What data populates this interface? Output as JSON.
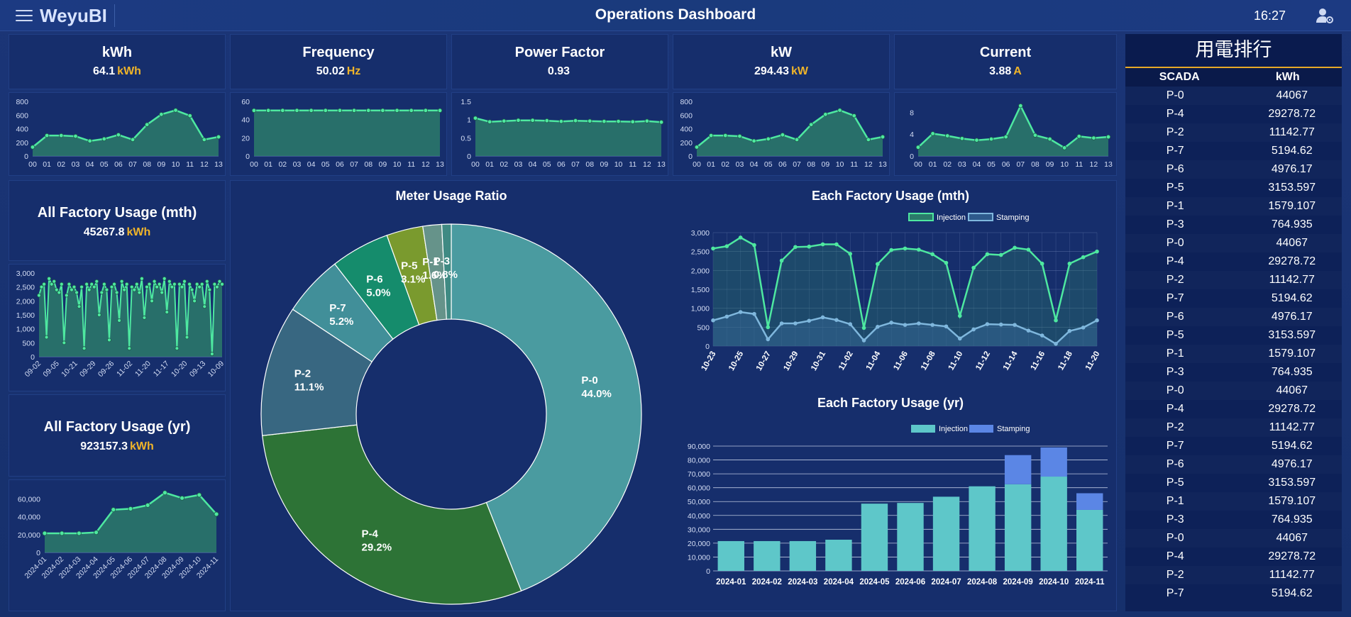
{
  "header": {
    "app_name": "WeyuBI",
    "title": "Operations Dashboard",
    "time": "16:27"
  },
  "kpis": [
    {
      "title": "kWh",
      "value": "64.1",
      "unit": "kWh"
    },
    {
      "title": "Frequency",
      "value": "50.02",
      "unit": "Hz"
    },
    {
      "title": "Power Factor",
      "value": "0.93",
      "unit": ""
    },
    {
      "title": "kW",
      "value": "294.43",
      "unit": "kW"
    },
    {
      "title": "Current",
      "value": "3.88",
      "unit": "A"
    }
  ],
  "summary": {
    "mth": {
      "title": "All Factory Usage (mth)",
      "value": "45267.8",
      "unit": "kWh"
    },
    "yr": {
      "title": "All Factory Usage (yr)",
      "value": "923157.3",
      "unit": "kWh"
    }
  },
  "colors": {
    "accent": "#f0b429",
    "line": "#4ee8a0",
    "area": "#2b7a6a",
    "injection": "#5ec7c9",
    "stamping": "#5b86e5"
  },
  "chart_data": [
    {
      "id": "kwh_trend",
      "type": "area",
      "categories": [
        "00",
        "01",
        "02",
        "03",
        "04",
        "05",
        "06",
        "07",
        "08",
        "09",
        "10",
        "11",
        "12",
        "13"
      ],
      "values": [
        130,
        300,
        300,
        290,
        220,
        250,
        310,
        240,
        460,
        610,
        670,
        590,
        240,
        280
      ],
      "ylim": [
        0,
        800
      ],
      "yticks": [
        0,
        200,
        400,
        600,
        800
      ]
    },
    {
      "id": "freq_trend",
      "type": "area",
      "categories": [
        "00",
        "01",
        "02",
        "03",
        "04",
        "05",
        "06",
        "07",
        "08",
        "09",
        "10",
        "11",
        "12",
        "13"
      ],
      "values": [
        50,
        50,
        50,
        50,
        50,
        50,
        50,
        50,
        50,
        50,
        50,
        50,
        50,
        50
      ],
      "ylim": [
        0,
        60
      ],
      "yticks": [
        0,
        20,
        40,
        60
      ]
    },
    {
      "id": "pf_trend",
      "type": "area",
      "categories": [
        "00",
        "01",
        "02",
        "03",
        "04",
        "05",
        "06",
        "07",
        "08",
        "09",
        "10",
        "11",
        "12",
        "13"
      ],
      "values": [
        1.04,
        0.94,
        0.96,
        0.98,
        0.98,
        0.97,
        0.95,
        0.97,
        0.96,
        0.95,
        0.95,
        0.94,
        0.96,
        0.93
      ],
      "ylim": [
        0,
        1.5
      ],
      "yticks": [
        0,
        0.5,
        1.0,
        1.5
      ]
    },
    {
      "id": "kw_trend",
      "type": "area",
      "categories": [
        "00",
        "01",
        "02",
        "03",
        "04",
        "05",
        "06",
        "07",
        "08",
        "09",
        "10",
        "11",
        "12",
        "13"
      ],
      "values": [
        130,
        300,
        300,
        290,
        220,
        250,
        310,
        240,
        460,
        610,
        670,
        590,
        240,
        280
      ],
      "ylim": [
        0,
        800
      ],
      "yticks": [
        0,
        200,
        400,
        600,
        800
      ]
    },
    {
      "id": "current_trend",
      "type": "area",
      "categories": [
        "00",
        "01",
        "02",
        "03",
        "04",
        "05",
        "06",
        "07",
        "08",
        "09",
        "10",
        "11",
        "12",
        "13"
      ],
      "values": [
        1.6,
        4.1,
        3.7,
        3.2,
        2.9,
        3.1,
        3.5,
        9.2,
        3.8,
        3.1,
        1.5,
        3.6,
        3.3,
        3.5
      ],
      "ylim": [
        0,
        10
      ],
      "yticks": [
        0,
        4,
        8
      ]
    },
    {
      "id": "mth_trend",
      "type": "area",
      "categories": [
        "09-02",
        "09-05",
        "10-21",
        "09-29",
        "09-26",
        "11-02",
        "11-20",
        "11-17",
        "10-20",
        "09-13",
        "10-09"
      ],
      "values": [
        2200,
        2500,
        2600,
        700,
        2800,
        2600,
        2700,
        2400,
        2300,
        2600,
        500,
        2200,
        2600,
        2400,
        2500,
        2300,
        1800,
        2500,
        300,
        2600,
        2400,
        2600,
        2500,
        2700,
        1500,
        2300,
        2600,
        2400,
        600,
        2500,
        2600,
        2300,
        1300,
        2700,
        2400,
        2600,
        300,
        2500,
        2400,
        2600,
        2300,
        2800,
        1400,
        2500,
        2600,
        2000,
        2700,
        2500,
        2600,
        2300,
        2800,
        1600,
        2700,
        2500,
        2600,
        300,
        2600,
        2500,
        2700,
        700,
        2600,
        2400,
        2000,
        2600,
        2500,
        2600,
        1800,
        2700,
        2400,
        100,
        2600,
        2500,
        2700,
        2600
      ],
      "ylim": [
        0,
        3000
      ],
      "yticks": [
        0,
        500,
        1000,
        1500,
        2000,
        2500,
        3000
      ]
    },
    {
      "id": "yr_trend",
      "type": "area",
      "categories": [
        "2024-01",
        "2024-02",
        "2024-03",
        "2024-04",
        "2024-05",
        "2024-06",
        "2024-07",
        "2024-08",
        "2024-09",
        "2024-10",
        "2024-11"
      ],
      "values": [
        21500,
        21500,
        21500,
        22500,
        48000,
        49000,
        53000,
        67000,
        61000,
        64500,
        43000
      ],
      "ylim": [
        0,
        70000
      ],
      "yticks": [
        0,
        20000,
        40000,
        60000
      ]
    },
    {
      "id": "meter_ratio",
      "type": "pie",
      "title": "Meter Usage Ratio",
      "labels": [
        "P-0",
        "P-4",
        "P-2",
        "P-7",
        "P-6",
        "P-5",
        "P-1",
        "P-3"
      ],
      "values": [
        44.0,
        29.2,
        11.1,
        5.2,
        5.0,
        3.1,
        1.6,
        0.8
      ],
      "display": [
        "44.0%",
        "29.2%",
        "11.1%",
        "5.2%",
        "5.0%",
        "3.1%",
        "1.6%",
        "0.8%"
      ],
      "colors": [
        "#4a9ba0",
        "#2d7336",
        "#386781",
        "#418f99",
        "#158c6c",
        "#7a9a2e",
        "#66938a",
        "#3f8a83"
      ]
    },
    {
      "id": "factory_mth",
      "type": "line",
      "title": "Each Factory Usage (mth)",
      "categories": [
        "10-23",
        "10-24",
        "10-25",
        "10-26",
        "10-27",
        "10-28",
        "10-29",
        "10-30",
        "10-31",
        "11-01",
        "11-02",
        "11-03",
        "11-04",
        "11-05",
        "11-06",
        "11-07",
        "11-08",
        "11-09",
        "11-10",
        "11-11",
        "11-12",
        "11-13",
        "11-14",
        "11-15",
        "11-16",
        "11-17",
        "11-18",
        "11-19",
        "11-20"
      ],
      "tick_labels": [
        "10-23",
        "10-25",
        "10-27",
        "10-29",
        "10-31",
        "11-02",
        "11-04",
        "11-06",
        "11-08",
        "11-10",
        "11-12",
        "11-14",
        "11-16",
        "11-18",
        "11-20"
      ],
      "series": [
        {
          "name": "Injection",
          "values": [
            2580,
            2640,
            2870,
            2670,
            500,
            2260,
            2620,
            2630,
            2690,
            2690,
            2440,
            480,
            2170,
            2540,
            2580,
            2550,
            2430,
            2200,
            800,
            2070,
            2430,
            2410,
            2600,
            2550,
            2180,
            680,
            2180,
            2350,
            2500
          ]
        },
        {
          "name": "Stamping",
          "values": [
            680,
            780,
            900,
            850,
            180,
            600,
            600,
            670,
            760,
            690,
            580,
            150,
            510,
            620,
            560,
            600,
            560,
            520,
            200,
            440,
            580,
            570,
            560,
            410,
            280,
            60,
            400,
            490,
            680
          ]
        }
      ],
      "ylim": [
        0,
        3000
      ],
      "yticks": [
        0,
        500,
        1000,
        1500,
        2000,
        2500,
        3000
      ]
    },
    {
      "id": "factory_yr",
      "type": "bar",
      "title": "Each Factory Usage (yr)",
      "categories": [
        "2024-01",
        "2024-02",
        "2024-03",
        "2024-04",
        "2024-05",
        "2024-06",
        "2024-07",
        "2024-08",
        "2024-09",
        "2024-10",
        "2024-11"
      ],
      "series": [
        {
          "name": "Injection",
          "values": [
            21500,
            21500,
            21500,
            22500,
            48500,
            49000,
            53500,
            61000,
            62500,
            68000,
            44000
          ]
        },
        {
          "name": "Stamping",
          "values": [
            0,
            0,
            0,
            0,
            0,
            0,
            0,
            0,
            21000,
            21000,
            12000
          ]
        }
      ],
      "ylim": [
        0,
        90000
      ],
      "yticks": [
        0,
        10000,
        20000,
        30000,
        40000,
        50000,
        60000,
        70000,
        80000,
        90000
      ]
    }
  ],
  "ranking": {
    "title": "用電排行",
    "headers": [
      "SCADA",
      "kWh"
    ],
    "rows": [
      [
        "P-0",
        "44067"
      ],
      [
        "P-4",
        "29278.72"
      ],
      [
        "P-2",
        "11142.77"
      ],
      [
        "P-7",
        "5194.62"
      ],
      [
        "P-6",
        "4976.17"
      ],
      [
        "P-5",
        "3153.597"
      ],
      [
        "P-1",
        "1579.107"
      ],
      [
        "P-3",
        "764.935"
      ],
      [
        "P-0",
        "44067"
      ],
      [
        "P-4",
        "29278.72"
      ],
      [
        "P-2",
        "11142.77"
      ],
      [
        "P-7",
        "5194.62"
      ],
      [
        "P-6",
        "4976.17"
      ],
      [
        "P-5",
        "3153.597"
      ],
      [
        "P-1",
        "1579.107"
      ],
      [
        "P-3",
        "764.935"
      ],
      [
        "P-0",
        "44067"
      ],
      [
        "P-4",
        "29278.72"
      ],
      [
        "P-2",
        "11142.77"
      ],
      [
        "P-7",
        "5194.62"
      ],
      [
        "P-6",
        "4976.17"
      ],
      [
        "P-5",
        "3153.597"
      ],
      [
        "P-1",
        "1579.107"
      ],
      [
        "P-3",
        "764.935"
      ],
      [
        "P-0",
        "44067"
      ],
      [
        "P-4",
        "29278.72"
      ],
      [
        "P-2",
        "11142.77"
      ],
      [
        "P-7",
        "5194.62"
      ]
    ]
  }
}
